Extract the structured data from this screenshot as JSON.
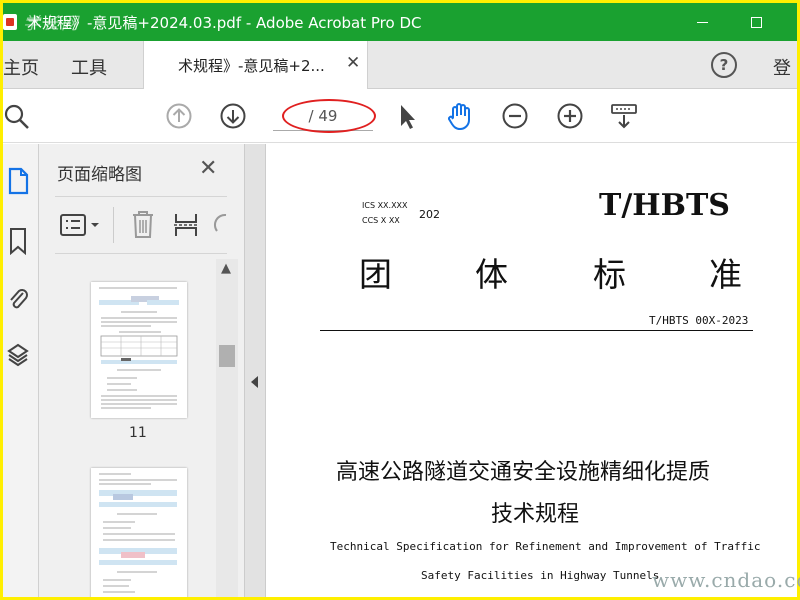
{
  "titlebar": {
    "title": "术规程》-意见稿+2024.03.pdf - Adobe Acrobat Pro DC",
    "watermark": "学长网"
  },
  "tabs": {
    "home": "主页",
    "tools": "工具",
    "document": "术规程》-意见稿+2...",
    "close": "✕",
    "login": "登"
  },
  "toolbar": {
    "page_indicator": "/ 49"
  },
  "panel": {
    "title": "页面缩略图",
    "close": "✕",
    "page_number": "11"
  },
  "document": {
    "ics": "ICS   XX.XXX",
    "ccs": "CCS   X XX",
    "year": "202",
    "standard_code": "T/HBTS",
    "category_chars": [
      "团",
      "体",
      "标",
      "准"
    ],
    "standard_number": "T/HBTS 00X-2023",
    "title_cn_line1": "高速公路隧道交通安全设施精细化提质",
    "title_cn_line2": "技术规程",
    "title_en_line1": "Technical Specification for Refinement and Improvement of Traffic",
    "title_en_line2": "Safety Facilities in Highway Tunnels"
  },
  "footer_watermark": "www.cndao.com"
}
